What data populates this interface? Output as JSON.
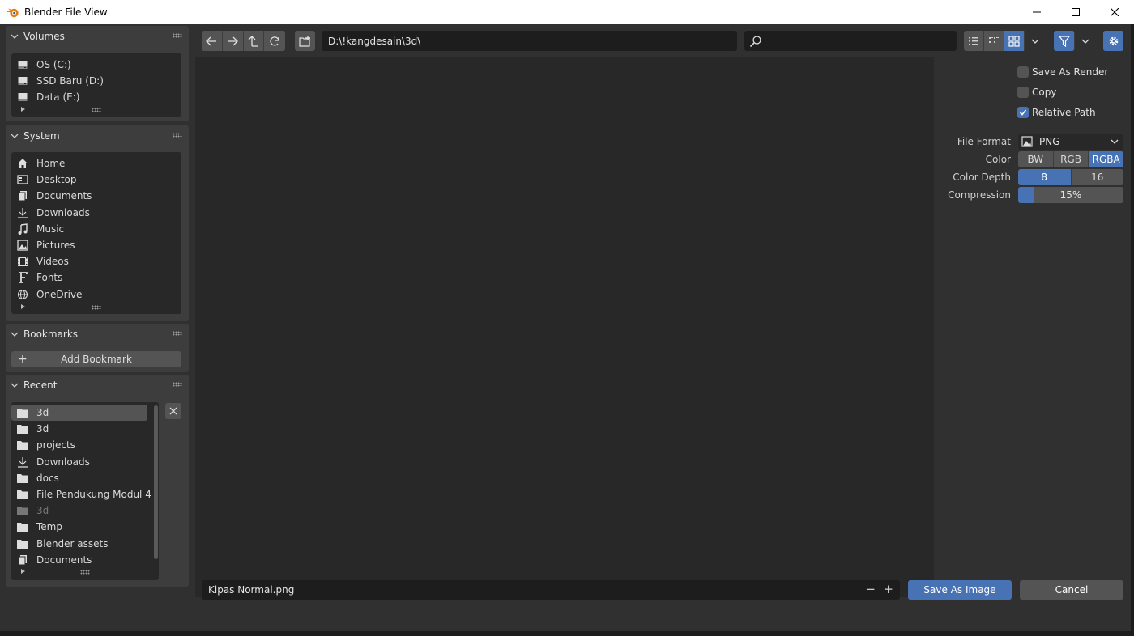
{
  "window": {
    "title": "Blender File View"
  },
  "sidebar": {
    "volumes": {
      "title": "Volumes",
      "items": [
        {
          "label": "OS (C:)",
          "icon": "disk-icon"
        },
        {
          "label": "SSD Baru (D:)",
          "icon": "disk-icon"
        },
        {
          "label": "Data (E:)",
          "icon": "disk-icon"
        }
      ]
    },
    "system": {
      "title": "System",
      "items": [
        {
          "label": "Home",
          "icon": "home-icon"
        },
        {
          "label": "Desktop",
          "icon": "desktop-icon"
        },
        {
          "label": "Documents",
          "icon": "documents-icon"
        },
        {
          "label": "Downloads",
          "icon": "download-icon"
        },
        {
          "label": "Music",
          "icon": "music-icon"
        },
        {
          "label": "Pictures",
          "icon": "pictures-icon"
        },
        {
          "label": "Videos",
          "icon": "videos-icon"
        },
        {
          "label": "Fonts",
          "icon": "font-icon"
        },
        {
          "label": "OneDrive",
          "icon": "network-icon"
        }
      ]
    },
    "bookmarks": {
      "title": "Bookmarks",
      "add_label": "Add Bookmark"
    },
    "recent": {
      "title": "Recent",
      "items": [
        {
          "label": "3d",
          "icon": "folder-icon",
          "selected": true
        },
        {
          "label": "3d",
          "icon": "folder-icon"
        },
        {
          "label": "projects",
          "icon": "folder-icon"
        },
        {
          "label": "Downloads",
          "icon": "download-icon"
        },
        {
          "label": "docs",
          "icon": "folder-icon"
        },
        {
          "label": "File Pendukung Modul 4",
          "icon": "folder-icon"
        },
        {
          "label": "3d",
          "icon": "folder-icon",
          "dim": true
        },
        {
          "label": "Temp",
          "icon": "folder-icon"
        },
        {
          "label": "Blender assets",
          "icon": "folder-icon"
        },
        {
          "label": "Documents",
          "icon": "documents-icon"
        }
      ]
    }
  },
  "toolbar": {
    "path": "D:\\!kangdesain\\3d\\",
    "search_value": ""
  },
  "options": {
    "save_as_render": {
      "label": "Save As Render",
      "checked": false
    },
    "copy": {
      "label": "Copy",
      "checked": false
    },
    "relative_path": {
      "label": "Relative Path",
      "checked": true
    },
    "file_format": {
      "label": "File Format",
      "value": "PNG"
    },
    "color": {
      "label": "Color",
      "options": [
        "BW",
        "RGB",
        "RGBA"
      ],
      "selected": "RGBA"
    },
    "color_depth": {
      "label": "Color Depth",
      "options": [
        "8",
        "16"
      ],
      "selected": "8"
    },
    "compression": {
      "label": "Compression",
      "value": "15%",
      "fraction": 0.15
    }
  },
  "footer": {
    "filename": "Kipas Normal.png",
    "save_label": "Save As Image",
    "cancel_label": "Cancel"
  },
  "colors": {
    "accent": "#4772b3",
    "panel": "#3d3d3d",
    "background": "#303030",
    "field": "#282828"
  }
}
